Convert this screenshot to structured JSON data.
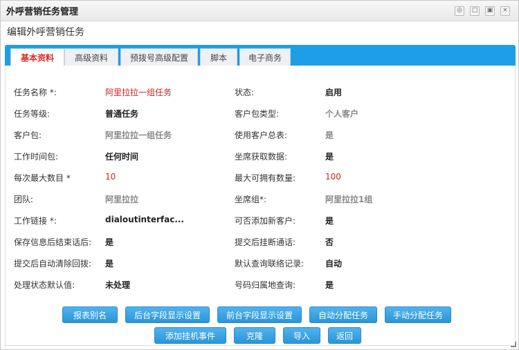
{
  "window": {
    "title": "外呼营销任务管理"
  },
  "subtitle": "编辑外呼营销任务",
  "tabs": [
    {
      "label": "基本资料",
      "active": true
    },
    {
      "label": "高级资料"
    },
    {
      "label": "预拨号高级配置"
    },
    {
      "label": "脚本"
    },
    {
      "label": "电子商务"
    }
  ],
  "fields": [
    {
      "label1": "任务名称 *:",
      "value1": "阿里拉拉一组任务",
      "label2": "状态:",
      "value2": "启用"
    },
    {
      "label1": "任务等级:",
      "value1": "普通任务",
      "label2": "客户包类型:",
      "value2": "个人客户"
    },
    {
      "label1": "客户包:",
      "value1": "阿里拉拉一组任务",
      "label2": "使用客户总表:",
      "value2": "是"
    },
    {
      "label1": "工作时间包:",
      "value1": "任何时间",
      "label2": "坐席获取数据:",
      "value2": "是"
    },
    {
      "label1": "每次最大数目 *",
      "value1": "10",
      "label2": "最大可拥有数量:",
      "value2": "100"
    },
    {
      "label1": "团队:",
      "value1": "阿里拉拉",
      "label2": "坐席组*:",
      "value2": "阿里拉拉1组"
    },
    {
      "label1": "工作链接 *:",
      "value1": "dialoutinterfac...",
      "label2": "可否添加新客户:",
      "value2": "是"
    },
    {
      "label1": "保存信息后结束话后:",
      "value1": "是",
      "label2": "提交后挂断通话:",
      "value2": "否"
    },
    {
      "label1": "提交后自动清除回拨:",
      "value1": "是",
      "label2": "默认查询联络记录:",
      "value2": "自动"
    },
    {
      "label1": "处理状态默认值:",
      "value1": "未处理",
      "label2": "号码归属地查询:",
      "value2": "是"
    }
  ],
  "buttons": {
    "report_alias": "报表别名",
    "backend_fields": "后台字段显示设置",
    "frontend_fields": "前台字段显示设置",
    "auto_assign": "自动分配任务",
    "manual_assign": "手动分配任务",
    "add_hangup_event": "添加挂机事件",
    "clone": "克隆",
    "import": "导入",
    "back": "返回"
  },
  "colors": {
    "accent": "#1e9ee6",
    "active_tab_text": "#d92b2b",
    "value_red": "#cc2222"
  }
}
